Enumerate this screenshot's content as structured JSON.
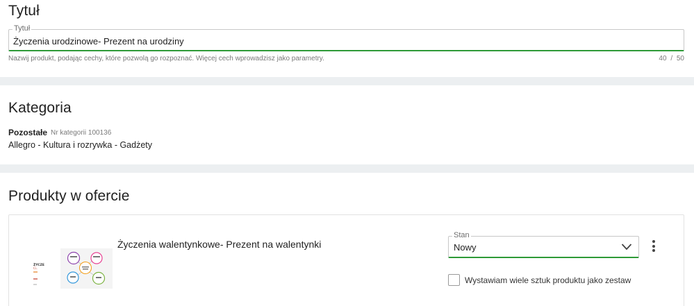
{
  "title_section": {
    "heading": "Tytuł",
    "field_legend": "Tytuł",
    "field_value": "Życzenia urodzinowe- Prezent na urodziny",
    "helper_text": "Nazwij produkt, podając cechy, które pozwolą go rozpoznać. Więcej cech wprowadzisz jako parametry.",
    "char_count": "40",
    "char_separator": "/",
    "char_max": "50"
  },
  "category_section": {
    "heading": "Kategoria",
    "name": "Pozostałe",
    "number_text": "Nr kategorii 100136",
    "path": "Allegro - Kultura i rozrywka - Gadżety"
  },
  "products_section": {
    "heading": "Produkty w ofercie",
    "product": {
      "title": "Życzenia walentynkowe- Prezent na walentynki",
      "condition_legend": "Stan",
      "condition_value": "Nowy",
      "set_checkbox_label": "Wystawiam wiele sztuk produktu jako zestaw",
      "set_checkbox_checked": false
    }
  },
  "colors": {
    "accent_green": "#2e9a37",
    "divider_gray": "#eceff1",
    "border_gray": "#c8c8c8"
  },
  "icons": {
    "select_arrow": "chevron-down-icon",
    "more_menu": "kebab-menu-icon"
  }
}
